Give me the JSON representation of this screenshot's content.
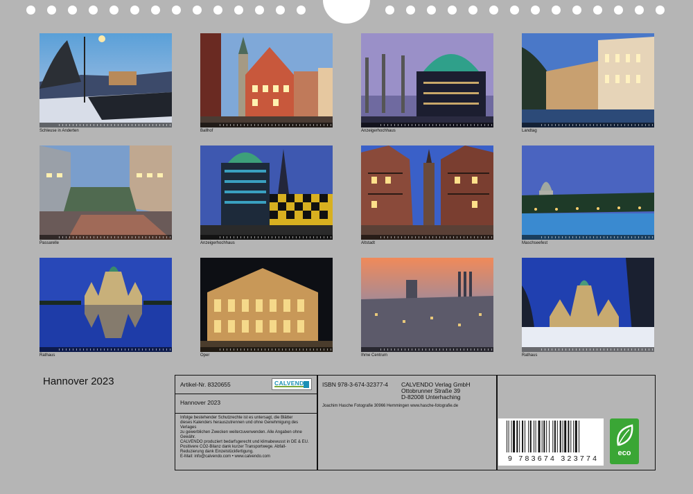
{
  "photos": [
    {
      "caption": "Schleuse in Anderten",
      "strip": "Januar 2023"
    },
    {
      "caption": "Ballhof",
      "strip": "Februar 2023"
    },
    {
      "caption": "Anzeigerhochhaus",
      "strip": "März 2023"
    },
    {
      "caption": "Landtag",
      "strip": "April 2023"
    },
    {
      "caption": "Passarelle",
      "strip": "Mai 2023"
    },
    {
      "caption": "Anzeigerhochhaus",
      "strip": "Juni 2023"
    },
    {
      "caption": "Altstadt",
      "strip": "Juli 2023"
    },
    {
      "caption": "Maschseefest",
      "strip": "August 2023"
    },
    {
      "caption": "Rathaus",
      "strip": "September 2023"
    },
    {
      "caption": "Oper",
      "strip": "Oktober 2023"
    },
    {
      "caption": "Ihme Centrum",
      "strip": "November 2023"
    },
    {
      "caption": "Rathaus",
      "strip": "Dezember 2023"
    }
  ],
  "calendar_title": "Hannover 2023",
  "info": {
    "article_label": "Artikel-Nr. 8320655",
    "product_title": "Hannover 2023",
    "legal_text": [
      "Infolge bestehender Schutzrechte ist es untersagt, die Blätter",
      "dieses Kalenders herauszutrennen und ohne Genehmigung des Verlages",
      "zu gewerblichen Zwecken weiterzuverwenden. Alle Angaben ohne",
      "Gewähr.",
      "CALVENDO produziert bedarfsgerecht und klimabewusst in DE & EU.",
      "Positivere CO2-Bilanz dank kurzer Transportwege. Abfall-",
      "Reduzierung dank Einzelstückfertigung.",
      "E-Mail: info@calvendo.com • www.calvendo.com"
    ],
    "isbn": "ISBN 978-3-674-32377-4",
    "publisher_name": "CALVENDO Verlag GmbH",
    "publisher_street": "Ottobrunner Straße 39",
    "publisher_city": "D-82008 Unterhaching",
    "photographer": "Joachim Hasche Fotografie 30966 Hemmingen www.hasche-fotografie.de",
    "calvendo_logo": "CALVENDO",
    "barcode_digits": "9 783674 323774",
    "eco_label": "eco"
  },
  "colors": {
    "page_background": "#b5b5b5",
    "calvendo_blue": "#1a8fb5",
    "eco_green": "#3aa635"
  }
}
